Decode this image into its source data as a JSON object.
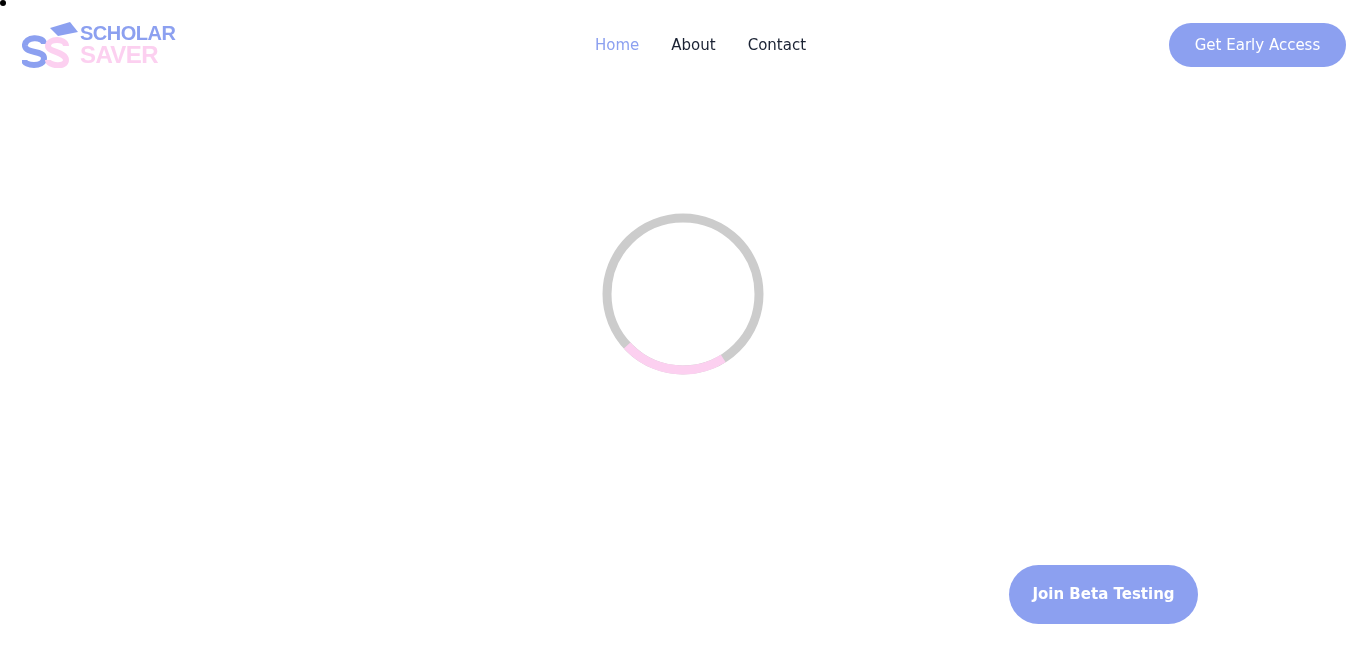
{
  "logo": {
    "line_1": "SCHOLAR",
    "line_2": "SAVER"
  },
  "nav": [
    {
      "label": "Home",
      "selected": true
    },
    {
      "label": "About",
      "selected": false
    },
    {
      "label": "Contact",
      "selected": false
    }
  ],
  "header_button": "Get Early Access",
  "loader": {
    "level": 0.22
  },
  "cta_button": "Join Beta Testing"
}
